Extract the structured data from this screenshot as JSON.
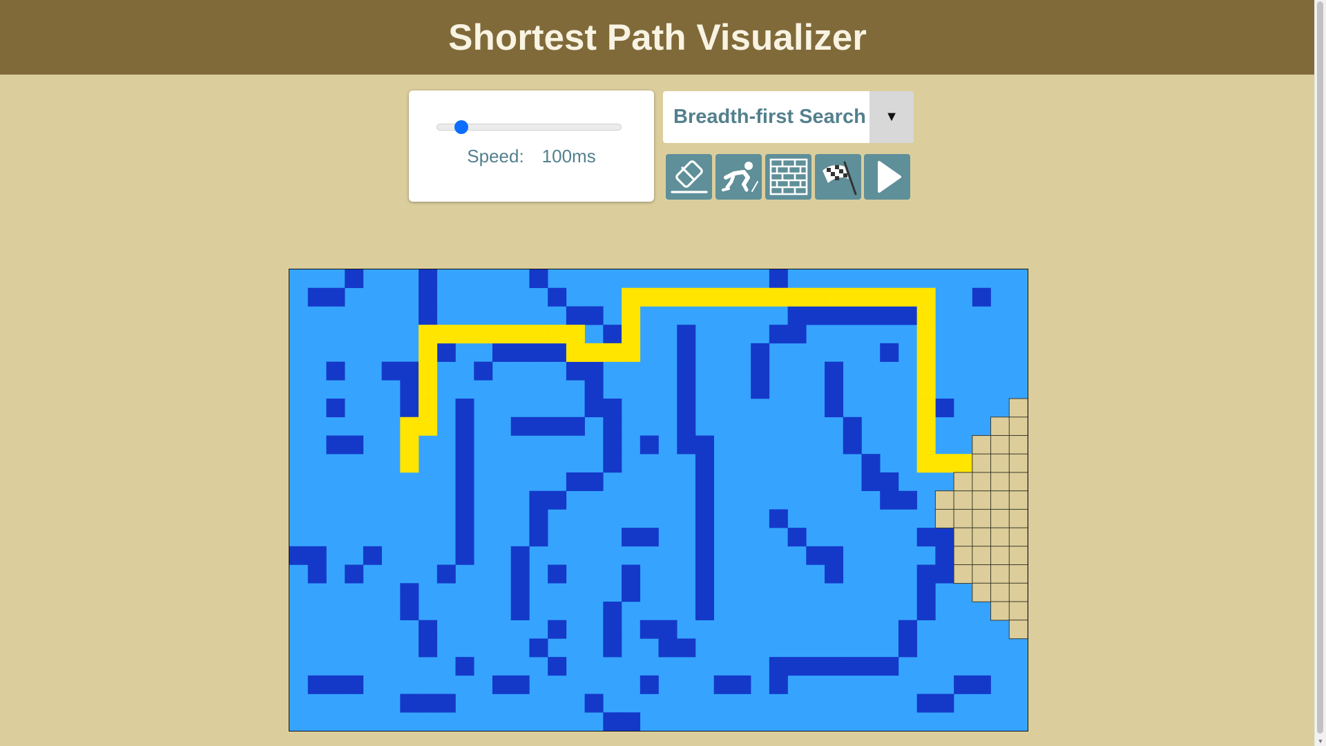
{
  "header": {
    "title": "Shortest Path Visualizer"
  },
  "speed_control": {
    "label": "Speed:",
    "value": "100ms",
    "slider_fraction": 0.13
  },
  "algorithm_select": {
    "selected": "Breadth-first Search"
  },
  "toolbar": {
    "buttons": [
      {
        "name": "clear-board-button",
        "icon": "eraser-icon"
      },
      {
        "name": "set-start-button",
        "icon": "runner-icon"
      },
      {
        "name": "draw-walls-button",
        "icon": "brick-wall-icon"
      },
      {
        "name": "set-finish-button",
        "icon": "checkered-flag-icon"
      },
      {
        "name": "run-button",
        "icon": "play-icon"
      }
    ]
  },
  "colors": {
    "background": "#dbce9c",
    "header": "#816a3a",
    "open_cell": "#36a4ff",
    "wall_cell": "#1439c8",
    "path_cell": "#ffe500",
    "visited_cell": "#dccd9a",
    "button": "#5f8f99"
  },
  "grid": {
    "cols": 40,
    "rows": 25,
    "walls": [
      [
        3,
        0
      ],
      [
        7,
        0
      ],
      [
        13,
        0
      ],
      [
        26,
        0
      ],
      [
        1,
        1
      ],
      [
        2,
        1
      ],
      [
        7,
        1
      ],
      [
        14,
        1
      ],
      [
        37,
        1
      ],
      [
        7,
        2
      ],
      [
        15,
        2
      ],
      [
        16,
        2
      ],
      [
        27,
        2
      ],
      [
        28,
        2
      ],
      [
        29,
        2
      ],
      [
        30,
        2
      ],
      [
        31,
        2
      ],
      [
        32,
        2
      ],
      [
        33,
        2
      ],
      [
        17,
        3
      ],
      [
        21,
        3
      ],
      [
        26,
        3
      ],
      [
        27,
        3
      ],
      [
        8,
        4
      ],
      [
        11,
        4
      ],
      [
        12,
        4
      ],
      [
        13,
        4
      ],
      [
        14,
        4
      ],
      [
        21,
        4
      ],
      [
        25,
        4
      ],
      [
        32,
        4
      ],
      [
        2,
        5
      ],
      [
        5,
        5
      ],
      [
        6,
        5
      ],
      [
        10,
        5
      ],
      [
        15,
        5
      ],
      [
        16,
        5
      ],
      [
        21,
        5
      ],
      [
        25,
        5
      ],
      [
        29,
        5
      ],
      [
        6,
        6
      ],
      [
        16,
        6
      ],
      [
        21,
        6
      ],
      [
        25,
        6
      ],
      [
        29,
        6
      ],
      [
        2,
        7
      ],
      [
        6,
        7
      ],
      [
        9,
        7
      ],
      [
        16,
        7
      ],
      [
        17,
        7
      ],
      [
        21,
        7
      ],
      [
        29,
        7
      ],
      [
        35,
        7
      ],
      [
        9,
        8
      ],
      [
        12,
        8
      ],
      [
        13,
        8
      ],
      [
        14,
        8
      ],
      [
        15,
        8
      ],
      [
        17,
        8
      ],
      [
        21,
        8
      ],
      [
        30,
        8
      ],
      [
        2,
        9
      ],
      [
        3,
        9
      ],
      [
        9,
        9
      ],
      [
        17,
        9
      ],
      [
        19,
        9
      ],
      [
        21,
        9
      ],
      [
        22,
        9
      ],
      [
        30,
        9
      ],
      [
        9,
        10
      ],
      [
        17,
        10
      ],
      [
        22,
        10
      ],
      [
        31,
        10
      ],
      [
        9,
        11
      ],
      [
        15,
        11
      ],
      [
        16,
        11
      ],
      [
        22,
        11
      ],
      [
        31,
        11
      ],
      [
        32,
        11
      ],
      [
        9,
        12
      ],
      [
        13,
        12
      ],
      [
        14,
        12
      ],
      [
        22,
        12
      ],
      [
        32,
        12
      ],
      [
        33,
        12
      ],
      [
        9,
        13
      ],
      [
        13,
        13
      ],
      [
        22,
        13
      ],
      [
        26,
        13
      ],
      [
        9,
        14
      ],
      [
        13,
        14
      ],
      [
        18,
        14
      ],
      [
        19,
        14
      ],
      [
        22,
        14
      ],
      [
        27,
        14
      ],
      [
        34,
        14
      ],
      [
        35,
        14
      ],
      [
        0,
        15
      ],
      [
        1,
        15
      ],
      [
        4,
        15
      ],
      [
        9,
        15
      ],
      [
        12,
        15
      ],
      [
        22,
        15
      ],
      [
        28,
        15
      ],
      [
        29,
        15
      ],
      [
        35,
        15
      ],
      [
        1,
        16
      ],
      [
        3,
        16
      ],
      [
        8,
        16
      ],
      [
        12,
        16
      ],
      [
        14,
        16
      ],
      [
        18,
        16
      ],
      [
        22,
        16
      ],
      [
        29,
        16
      ],
      [
        34,
        16
      ],
      [
        35,
        16
      ],
      [
        6,
        17
      ],
      [
        12,
        17
      ],
      [
        18,
        17
      ],
      [
        22,
        17
      ],
      [
        34,
        17
      ],
      [
        6,
        18
      ],
      [
        12,
        18
      ],
      [
        17,
        18
      ],
      [
        22,
        18
      ],
      [
        34,
        18
      ],
      [
        7,
        19
      ],
      [
        14,
        19
      ],
      [
        17,
        19
      ],
      [
        19,
        19
      ],
      [
        20,
        19
      ],
      [
        33,
        19
      ],
      [
        7,
        20
      ],
      [
        13,
        20
      ],
      [
        17,
        20
      ],
      [
        20,
        20
      ],
      [
        21,
        20
      ],
      [
        33,
        20
      ],
      [
        9,
        21
      ],
      [
        14,
        21
      ],
      [
        26,
        21
      ],
      [
        27,
        21
      ],
      [
        28,
        21
      ],
      [
        29,
        21
      ],
      [
        30,
        21
      ],
      [
        31,
        21
      ],
      [
        32,
        21
      ],
      [
        1,
        22
      ],
      [
        2,
        22
      ],
      [
        3,
        22
      ],
      [
        11,
        22
      ],
      [
        12,
        22
      ],
      [
        19,
        22
      ],
      [
        23,
        22
      ],
      [
        24,
        22
      ],
      [
        26,
        22
      ],
      [
        36,
        22
      ],
      [
        37,
        22
      ],
      [
        6,
        23
      ],
      [
        7,
        23
      ],
      [
        8,
        23
      ],
      [
        16,
        23
      ],
      [
        34,
        23
      ],
      [
        35,
        23
      ],
      [
        17,
        24
      ],
      [
        18,
        24
      ]
    ],
    "path": [
      [
        6,
        10
      ],
      [
        6,
        9
      ],
      [
        6,
        8
      ],
      [
        7,
        8
      ],
      [
        7,
        7
      ],
      [
        7,
        6
      ],
      [
        7,
        5
      ],
      [
        7,
        4
      ],
      [
        7,
        3
      ],
      [
        8,
        3
      ],
      [
        9,
        3
      ],
      [
        10,
        3
      ],
      [
        11,
        3
      ],
      [
        12,
        3
      ],
      [
        13,
        3
      ],
      [
        14,
        3
      ],
      [
        15,
        3
      ],
      [
        15,
        4
      ],
      [
        16,
        4
      ],
      [
        17,
        4
      ],
      [
        18,
        4
      ],
      [
        18,
        3
      ],
      [
        18,
        2
      ],
      [
        18,
        1
      ],
      [
        19,
        1
      ],
      [
        20,
        1
      ],
      [
        21,
        1
      ],
      [
        22,
        1
      ],
      [
        23,
        1
      ],
      [
        24,
        1
      ],
      [
        25,
        1
      ],
      [
        26,
        1
      ],
      [
        27,
        1
      ],
      [
        28,
        1
      ],
      [
        29,
        1
      ],
      [
        30,
        1
      ],
      [
        31,
        1
      ],
      [
        32,
        1
      ],
      [
        33,
        1
      ],
      [
        34,
        1
      ],
      [
        34,
        2
      ],
      [
        34,
        3
      ],
      [
        34,
        4
      ],
      [
        34,
        5
      ],
      [
        34,
        6
      ],
      [
        34,
        7
      ],
      [
        34,
        8
      ],
      [
        34,
        9
      ],
      [
        34,
        10
      ],
      [
        35,
        10
      ],
      [
        36,
        10
      ]
    ],
    "visited": [
      [
        39,
        7
      ],
      [
        38,
        8
      ],
      [
        39,
        8
      ],
      [
        37,
        9
      ],
      [
        38,
        9
      ],
      [
        39,
        9
      ],
      [
        37,
        10
      ],
      [
        38,
        10
      ],
      [
        39,
        10
      ],
      [
        36,
        11
      ],
      [
        37,
        11
      ],
      [
        38,
        11
      ],
      [
        39,
        11
      ],
      [
        35,
        12
      ],
      [
        36,
        12
      ],
      [
        37,
        12
      ],
      [
        38,
        12
      ],
      [
        39,
        12
      ],
      [
        35,
        13
      ],
      [
        36,
        13
      ],
      [
        37,
        13
      ],
      [
        38,
        13
      ],
      [
        39,
        13
      ],
      [
        36,
        14
      ],
      [
        37,
        14
      ],
      [
        38,
        14
      ],
      [
        39,
        14
      ],
      [
        36,
        15
      ],
      [
        37,
        15
      ],
      [
        38,
        15
      ],
      [
        39,
        15
      ],
      [
        36,
        16
      ],
      [
        37,
        16
      ],
      [
        38,
        16
      ],
      [
        39,
        16
      ],
      [
        37,
        17
      ],
      [
        38,
        17
      ],
      [
        39,
        17
      ],
      [
        38,
        18
      ],
      [
        39,
        18
      ],
      [
        39,
        19
      ]
    ]
  }
}
